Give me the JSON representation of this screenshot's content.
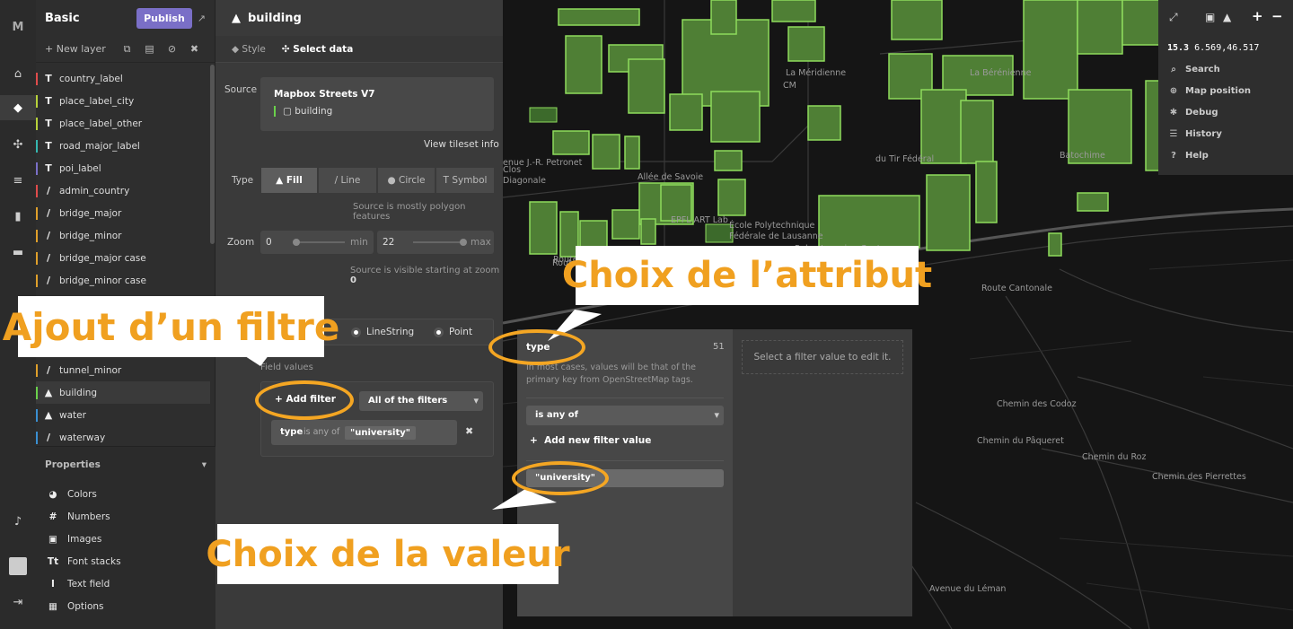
{
  "rail": {
    "logo": "M",
    "icons": [
      "home-icon",
      "paint-bucket-icon",
      "nodes-icon",
      "database-icon",
      "chart-icon",
      "folder-icon",
      "bell-icon",
      "user-icon",
      "logout-icon"
    ]
  },
  "sidebar": {
    "title": "Basic",
    "publish_label": "Publish",
    "new_layer_label": "New layer",
    "layers": [
      {
        "icon": "T",
        "label": "country_label",
        "color": "#e04b4b"
      },
      {
        "icon": "T",
        "label": "place_label_city",
        "color": "#b7d13a"
      },
      {
        "icon": "T",
        "label": "place_label_other",
        "color": "#b7d13a"
      },
      {
        "icon": "T",
        "label": "road_major_label",
        "color": "#35b7b0"
      },
      {
        "icon": "T",
        "label": "poi_label",
        "color": "#7a6fc7"
      },
      {
        "icon": "/",
        "label": "admin_country",
        "color": "#e04b4b"
      },
      {
        "icon": "/",
        "label": "bridge_major",
        "color": "#e0a02a"
      },
      {
        "icon": "/",
        "label": "bridge_minor",
        "color": "#e0a02a"
      },
      {
        "icon": "/",
        "label": "bridge_major case",
        "color": "#e0a02a"
      },
      {
        "icon": "/",
        "label": "bridge_minor case",
        "color": "#e0a02a"
      },
      {
        "icon": "/",
        "label": "tunnel_minor",
        "color": "#e0a02a"
      },
      {
        "icon": "▲",
        "label": "building",
        "color": "#6ad14b"
      },
      {
        "icon": "▲",
        "label": "water",
        "color": "#3a8fd1"
      },
      {
        "icon": "/",
        "label": "waterway",
        "color": "#3a8fd1"
      }
    ],
    "properties_title": "Properties",
    "properties": [
      {
        "icon": "◕",
        "label": "Colors"
      },
      {
        "icon": "#",
        "label": "Numbers"
      },
      {
        "icon": "▣",
        "label": "Images"
      },
      {
        "icon": "Tt",
        "label": "Font stacks"
      },
      {
        "icon": "I",
        "label": "Text field"
      },
      {
        "icon": "▦",
        "label": "Options"
      }
    ]
  },
  "editor": {
    "layer_name": "building",
    "tabs": [
      "Style",
      "Select data"
    ],
    "source_label": "Source",
    "source_name": "Mapbox Streets V7",
    "source_layer": "building",
    "view_tileset": "View tileset info",
    "type_label": "Type",
    "types": [
      "Fill",
      "Line",
      "Circle",
      "Symbol"
    ],
    "type_note": "Source is mostly polygon features",
    "zoom_label": "Zoom",
    "zoom_min": "0",
    "zoom_min_label": "min",
    "zoom_max": "22",
    "zoom_max_label": "max",
    "zoom_note": "Source is visible starting at zoom",
    "zoom_note_value": "0",
    "geometry_options": [
      "LineString",
      "Point"
    ],
    "field_values_label": "Field values",
    "add_filter": "Add filter",
    "filter_mode": "All of the filters",
    "filter_key": "type",
    "filter_op": "is any of",
    "filter_value": "\"university\""
  },
  "popup": {
    "attr": "type",
    "count": "51",
    "help": "In most cases, values will be that of the primary key from OpenStreetMap tags.",
    "operator": "is any of",
    "add_value": "Add new filter value",
    "value": "\"university\"",
    "right_hint": "Select a filter value to edit it."
  },
  "map": {
    "zoom": "15.3",
    "coords": "6.569,46.517",
    "menu": [
      "Search",
      "Map position",
      "Debug",
      "History",
      "Help"
    ],
    "labels": [
      "La Méridienne",
      "CM",
      "La Bérénienne",
      "Batochime",
      "du Tir Fédéral",
      "enue J.-R. Petronet",
      "Clos",
      "Diagonale",
      "Allée de Savoie",
      "EPFL ART Lab",
      "École Polytechnique",
      "Fédérale de Lausanne",
      "Rolex Learning Center",
      "Route de Bèvellaire",
      "Route Cantonale",
      "Route",
      "Chemin des Codoz",
      "Chemin du Pâqueret",
      "Chemin du Roz",
      "Chemin des Pierrettes",
      "Avenue du Léman"
    ]
  },
  "callouts": {
    "attribute": "Choix de l’attribut",
    "filter": "Ajout d’un filtre",
    "value": "Choix de la valeur"
  },
  "colors": {
    "accent": "#f4a623",
    "brand": "#7a6fc7",
    "building": "#6ad14b"
  }
}
